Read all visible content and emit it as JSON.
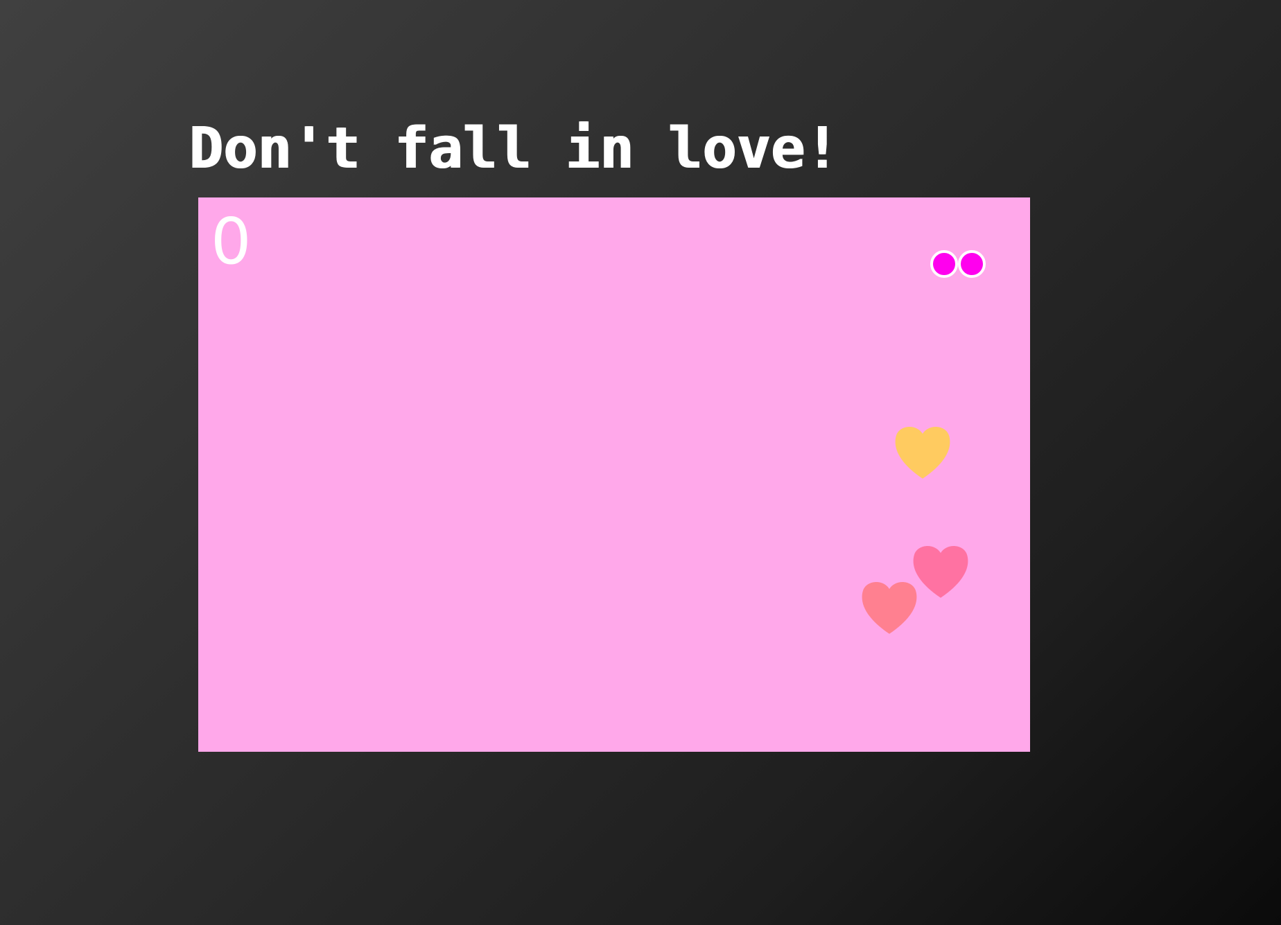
{
  "title": "Don't fall in love!",
  "score": "0",
  "colors": {
    "playfield": "#ffa8ea",
    "player_eyes": "#ff00ee",
    "player_eye_outline": "#ffffff",
    "heart_yellow": "#ffcb60",
    "heart_pink": "#ff72a2",
    "heart_salmon": "#ff8090"
  },
  "hearts": [
    {
      "color": "heart_yellow"
    },
    {
      "color": "heart_pink"
    },
    {
      "color": "heart_salmon"
    }
  ]
}
